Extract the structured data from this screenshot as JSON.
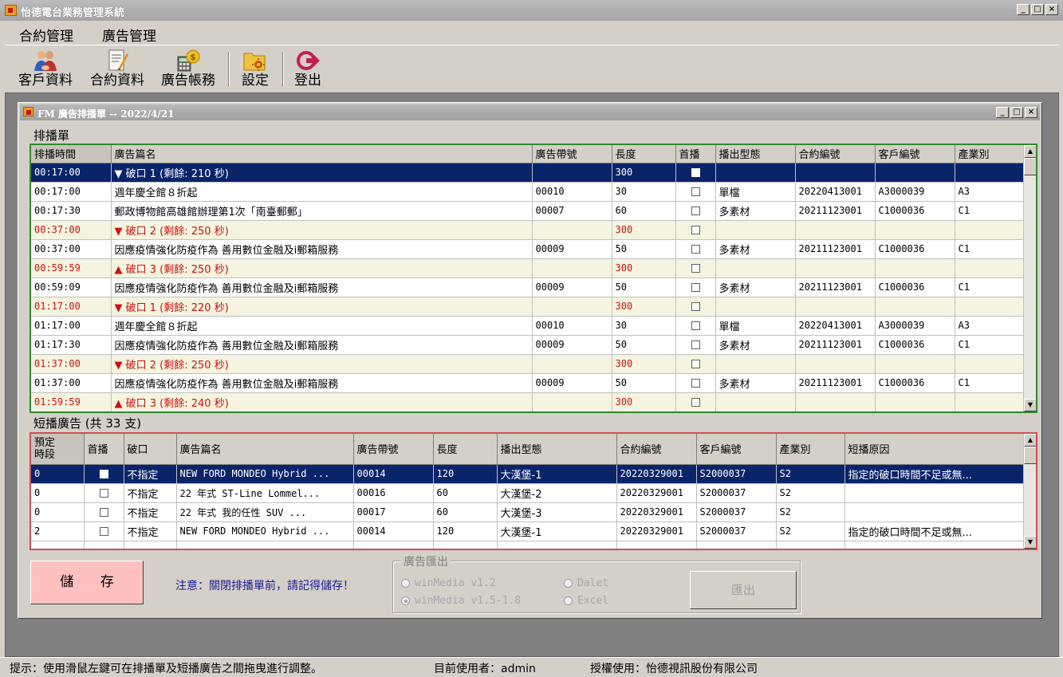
{
  "app": {
    "title": "怡德電台業務管理系統"
  },
  "menu": [
    "合約管理",
    "廣告管理"
  ],
  "toolbar": {
    "customers": "客戶資料",
    "contracts": "合約資料",
    "billing": "廣告帳務",
    "settings": "設定",
    "logout": "登出"
  },
  "child": {
    "title": "FM 廣告排播單 -- 2022/4/21"
  },
  "schedule": {
    "label": "排播單",
    "columns": [
      "排播時間",
      "廣告篇名",
      "廣告帶號",
      "長度",
      "首播",
      "播出型態",
      "合約編號",
      "客戶編號",
      "產業別"
    ],
    "rows": [
      {
        "type": "sel",
        "time": "00:17:00",
        "name": "▼  破口 1     (剩餘: 210 秒)",
        "tape": "",
        "len": "300",
        "fmt": "",
        "contract": "",
        "client": "",
        "ind": ""
      },
      {
        "type": "normal",
        "time": "00:17:00",
        "name": "週年慶全館８折起",
        "tape": "00010",
        "len": "30",
        "fmt": "單檔",
        "contract": "20220413001",
        "client": "A3000039",
        "ind": "A3"
      },
      {
        "type": "normal",
        "time": "00:17:30",
        "name": "郵政博物館高雄館辦理第1次「南臺郵郵」",
        "tape": "00007",
        "len": "60",
        "fmt": "多素材",
        "contract": "20211123001",
        "client": "C1000036",
        "ind": "C1"
      },
      {
        "type": "slot",
        "time": "00:37:00",
        "name": "▼  破口 2     (剩餘: 250 秒)",
        "tape": "",
        "len": "300",
        "fmt": "",
        "contract": "",
        "client": "",
        "ind": ""
      },
      {
        "type": "normal",
        "time": "00:37:00",
        "name": "因應疫情強化防疫作為 善用數位金融及i郵箱服務",
        "tape": "00009",
        "len": "50",
        "fmt": "多素材",
        "contract": "20211123001",
        "client": "C1000036",
        "ind": "C1"
      },
      {
        "type": "slot",
        "time": "00:59:59",
        "name": "▲  破口 3     (剩餘: 250 秒)",
        "tape": "",
        "len": "300",
        "fmt": "",
        "contract": "",
        "client": "",
        "ind": ""
      },
      {
        "type": "normal",
        "time": "00:59:09",
        "name": "因應疫情強化防疫作為 善用數位金融及i郵箱服務",
        "tape": "00009",
        "len": "50",
        "fmt": "多素材",
        "contract": "20211123001",
        "client": "C1000036",
        "ind": "C1"
      },
      {
        "type": "slot",
        "time": "01:17:00",
        "name": "▼  破口 1     (剩餘: 220 秒)",
        "tape": "",
        "len": "300",
        "fmt": "",
        "contract": "",
        "client": "",
        "ind": ""
      },
      {
        "type": "normal",
        "time": "01:17:00",
        "name": "週年慶全館８折起",
        "tape": "00010",
        "len": "30",
        "fmt": "單檔",
        "contract": "20220413001",
        "client": "A3000039",
        "ind": "A3"
      },
      {
        "type": "normal",
        "time": "01:17:30",
        "name": "因應疫情強化防疫作為 善用數位金融及i郵箱服務",
        "tape": "00009",
        "len": "50",
        "fmt": "多素材",
        "contract": "20211123001",
        "client": "C1000036",
        "ind": "C1"
      },
      {
        "type": "slot",
        "time": "01:37:00",
        "name": "▼  破口 2     (剩餘: 250 秒)",
        "tape": "",
        "len": "300",
        "fmt": "",
        "contract": "",
        "client": "",
        "ind": ""
      },
      {
        "type": "normal",
        "time": "01:37:00",
        "name": "因應疫情強化防疫作為 善用數位金融及i郵箱服務",
        "tape": "00009",
        "len": "50",
        "fmt": "多素材",
        "contract": "20211123001",
        "client": "C1000036",
        "ind": "C1"
      },
      {
        "type": "slot",
        "time": "01:59:59",
        "name": "▲  破口 3     (剩餘: 240 秒)",
        "tape": "",
        "len": "300",
        "fmt": "",
        "contract": "",
        "client": "",
        "ind": ""
      }
    ]
  },
  "short": {
    "label": "短播廣告 (共 33 支)",
    "columns": [
      "預定\n時段",
      "首播",
      "破口",
      "廣告篇名",
      "廣告帶號",
      "長度",
      "播出型態",
      "合約編號",
      "客戶編號",
      "產業別",
      "短播原因"
    ],
    "rows": [
      {
        "type": "sel",
        "slot": "0",
        "brk": "不指定",
        "name": "NEW FORD MONDEO Hybrid ...",
        "tape": "00014",
        "len": "120",
        "fmt": "大漢堡-1",
        "contract": "20220329001",
        "client": "S2000037",
        "ind": "S2",
        "reason": "指定的破口時間不足或無..."
      },
      {
        "type": "normal",
        "slot": "0",
        "brk": "不指定",
        "name": "22 年式  ST-Line Lommel...",
        "tape": "00016",
        "len": "60",
        "fmt": "大漢堡-2",
        "contract": "20220329001",
        "client": "S2000037",
        "ind": "S2",
        "reason": ""
      },
      {
        "type": "normal",
        "slot": "0",
        "brk": "不指定",
        "name": "22 年式  我的任性 SUV  ...",
        "tape": "00017",
        "len": "60",
        "fmt": "大漢堡-3",
        "contract": "20220329001",
        "client": "S2000037",
        "ind": "S2",
        "reason": ""
      },
      {
        "type": "normal",
        "slot": "2",
        "brk": "不指定",
        "name": "NEW FORD MONDEO Hybrid ...",
        "tape": "00014",
        "len": "120",
        "fmt": "大漢堡-1",
        "contract": "20220329001",
        "client": "S2000037",
        "ind": "S2",
        "reason": "指定的破口時間不足或無..."
      }
    ]
  },
  "actions": {
    "save": "儲 存",
    "notice": "注意：關閉排播單前，請記得儲存！"
  },
  "export": {
    "legend": "廣告匯出",
    "opt1": "winMedia v1.2",
    "opt2": "winMedia v1.5-1.8",
    "opt3": "Dalet",
    "opt4": "Excel",
    "button": "匯出"
  },
  "status": {
    "hint": "提示：使用滑鼠左鍵可在排播單及短播廣告之間拖曳進行調整。",
    "user": "目前使用者：admin",
    "license": "授權使用：怡德視訊股份有限公司"
  },
  "colors": {
    "selected": "#0a246a",
    "slot_bg": "#f4f4e0",
    "slot_text": "#d01010",
    "save_btn": "#ffc0c0",
    "schedule_border": "#2e8b2e",
    "short_border": "#d05050"
  }
}
